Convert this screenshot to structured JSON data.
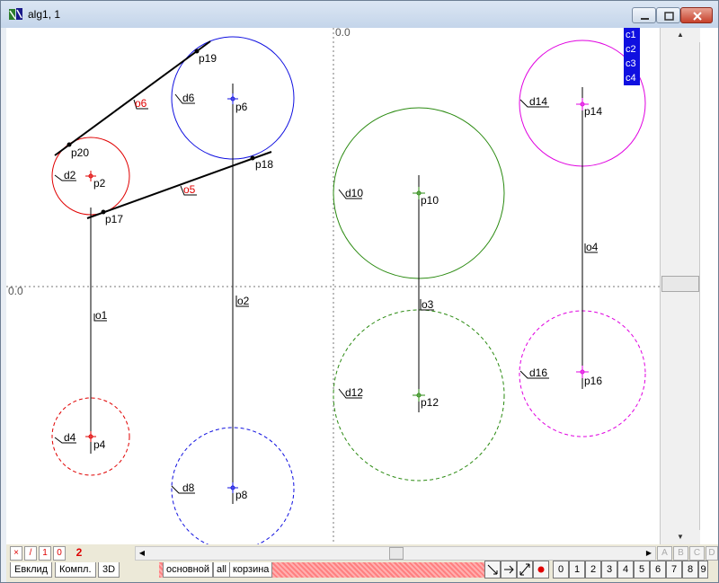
{
  "window": {
    "title": "alg1, 1"
  },
  "axis_labels": {
    "x": "0.0",
    "y": "0.0"
  },
  "layers": [
    "c1",
    "c2",
    "c3",
    "c4"
  ],
  "points": [
    "p2",
    "p4",
    "p6",
    "p8",
    "p10",
    "p12",
    "p14",
    "p16",
    "p17",
    "p18",
    "p19",
    "p20"
  ],
  "circles": [
    "d2",
    "d4",
    "d6",
    "d8",
    "d10",
    "d12",
    "d14",
    "d16"
  ],
  "lines": [
    "o1",
    "o2",
    "o3",
    "o4",
    "o5",
    "o6"
  ],
  "colors": {
    "red": "#e00000",
    "blue": "#1010e0",
    "green": "#2a8a10",
    "magenta": "#e000e0",
    "layer_bg": "#1010e0"
  },
  "bottom": {
    "mini_buttons": [
      "×",
      "/",
      "1",
      "0",
      "2"
    ],
    "mode_tabs": [
      "Евклид",
      "Компл.",
      "3D"
    ],
    "sheet_tabs": [
      "основной",
      "all",
      "корзина"
    ],
    "abcd": [
      "A",
      "B",
      "C",
      "D"
    ],
    "digits": [
      "0",
      "1",
      "2",
      "3",
      "4",
      "5",
      "6",
      "7",
      "8",
      "9",
      "↑"
    ]
  }
}
